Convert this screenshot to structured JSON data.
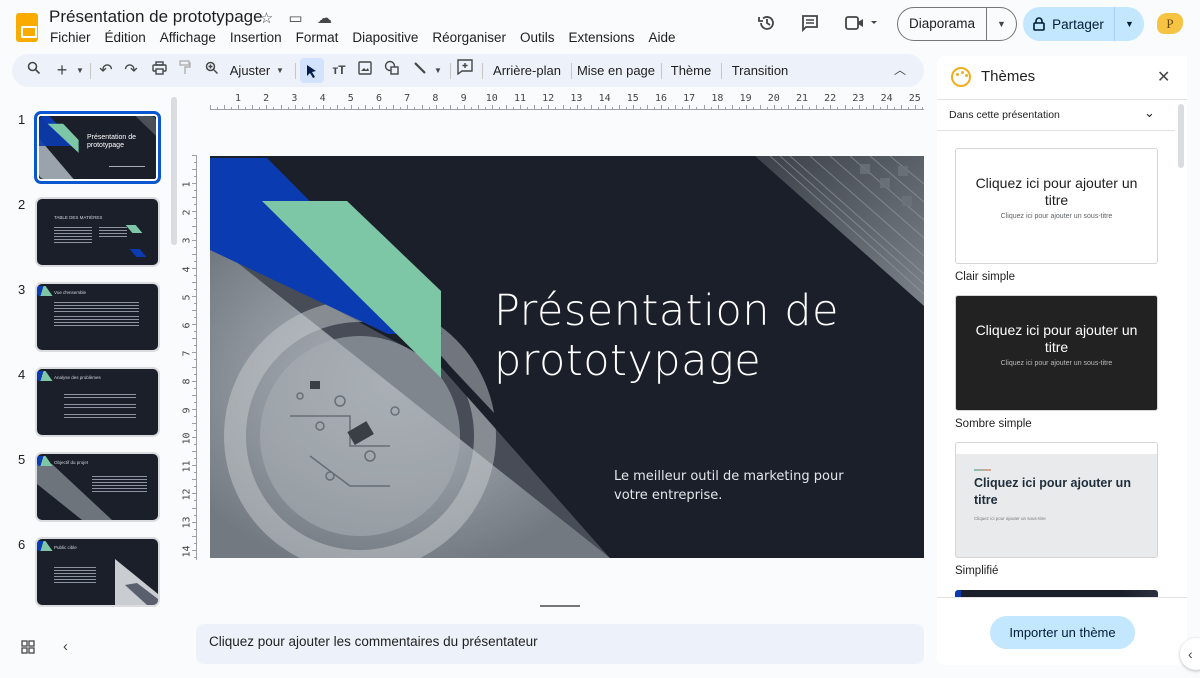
{
  "app": {
    "document_title": "Présentation de prototypage",
    "title_icons": [
      "star-icon",
      "move-to-folder-icon",
      "cloud-saved-icon"
    ]
  },
  "menu": [
    "Fichier",
    "Édition",
    "Affichage",
    "Insertion",
    "Format",
    "Diapositive",
    "Réorganiser",
    "Outils",
    "Extensions",
    "Aide"
  ],
  "header": {
    "slideshow_label": "Diaporama",
    "share_label": "Partager",
    "avatar_initial": "P",
    "icons": [
      "version-history-icon",
      "comments-icon",
      "meet-icon"
    ]
  },
  "toolbar": {
    "zoom_label": "Ajuster",
    "background_label": "Arrière-plan",
    "layout_label": "Mise en page",
    "theme_label": "Thème",
    "transition_label": "Transition"
  },
  "ruler": {
    "horizontal": [
      "1",
      "2",
      "3",
      "4",
      "5",
      "6",
      "7",
      "8",
      "9",
      "10",
      "11",
      "12",
      "13",
      "14",
      "15",
      "16",
      "17",
      "18",
      "19",
      "20",
      "21",
      "22",
      "23",
      "24",
      "25"
    ],
    "vertical": [
      "1",
      "2",
      "3",
      "4",
      "5",
      "6",
      "7",
      "8",
      "9",
      "10",
      "11",
      "12",
      "13",
      "14"
    ]
  },
  "slides": [
    {
      "number": "1",
      "title": "Présentation de prototypage",
      "active": true
    },
    {
      "number": "2",
      "title": "TABLE DES MATIÈRES"
    },
    {
      "number": "3",
      "title": "Vue d'ensemble"
    },
    {
      "number": "4",
      "title": "Analyse des problèmes"
    },
    {
      "number": "5",
      "title": "Objectif du projet"
    },
    {
      "number": "6",
      "title": "Public cible"
    }
  ],
  "current_slide": {
    "title": "Présentation de\nprototypage",
    "subtitle": "Le meilleur outil de marketing pour votre entreprise.",
    "colors": {
      "background": "#1b1f2a",
      "accent_blue": "#0b3bb0",
      "accent_green": "#7ec7a6"
    }
  },
  "notes": {
    "placeholder": "Cliquez pour ajouter les commentaires du présentateur"
  },
  "themes_panel": {
    "title": "Thèmes",
    "filter_label": "Dans cette présentation",
    "themes": [
      {
        "name": "Clair simple",
        "preview_title": "Cliquez ici pour ajouter un titre",
        "preview_subtitle": "Cliquez ici pour ajouter un sous-titre"
      },
      {
        "name": "Sombre simple",
        "preview_title": "Cliquez ici pour ajouter un titre",
        "preview_subtitle": "Cliquez ici pour ajouter un sous-titre"
      },
      {
        "name": "Simplifié",
        "preview_title": "Cliquez ici pour ajouter un titre",
        "preview_subtitle": "Cliquez ici pour ajouter un sous-titre"
      }
    ],
    "import_label": "Importer un thème"
  }
}
